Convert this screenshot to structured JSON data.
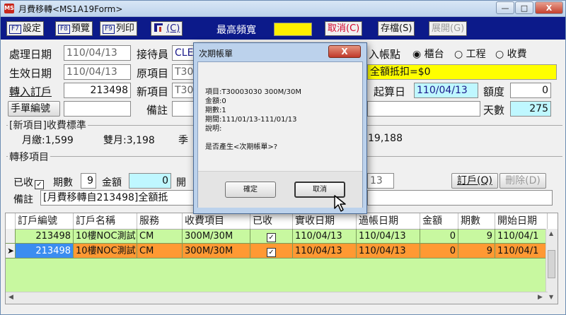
{
  "window": {
    "app_icon_text": "MS",
    "title": "月費移轉<MS1A19Form>",
    "minimize": "—",
    "maximize": "□",
    "close": "X"
  },
  "toolbar": {
    "set_key": "F7",
    "set_label": "設定",
    "preview_key": "F8",
    "preview_label": "預覽",
    "print_key": "F9",
    "print_label": "列印",
    "c_label": "(C)",
    "title": "最高頻寬",
    "cancel_label": "取消(C)",
    "save_label": "存檔(S)",
    "expand_label": "展開(G)"
  },
  "form": {
    "process_date_label": "處理日期",
    "process_date": "110/04/13",
    "operator_label": "接待員",
    "operator": "CLE",
    "entry_point_label": "入帳點",
    "entry_points": [
      "櫃台",
      "工程",
      "收費"
    ],
    "effective_date_label": "生效日期",
    "effective_date": "110/04/13",
    "orig_item_label": "原項目",
    "orig_item": "T30",
    "discount": "全額抵扣=$0",
    "transfer_customer_label": "轉入訂戶",
    "transfer_customer": "213498",
    "new_item_label": "新項目",
    "new_item": "T30",
    "calc_date_label": "起算日",
    "calc_date": "110/04/13",
    "quota_label": "額度",
    "quota": "0",
    "handbill_label": "手單編號",
    "remark_label": "備註",
    "days_label": "天數",
    "days": "275"
  },
  "fee_section": {
    "title": "[新項目]收費標準",
    "monthly": "月繳:1,599",
    "bimonthly": "雙月:3,198",
    "season": "季",
    "total": "19,188"
  },
  "transfer_section": {
    "title": "轉移項目",
    "received_label": "已收",
    "periods_label": "期數",
    "periods": "9",
    "amount_label": "金額",
    "amount": "0",
    "open_label": "開",
    "date_tail": "13",
    "remark_label": "備註",
    "remark": "[月費移轉自213498]全額抵",
    "customer_btn": "訂戶(Q)",
    "delete_btn": "刪除(D)"
  },
  "grid": {
    "headers": [
      "訂戶編號",
      "訂戶名稱",
      "服務",
      "收費項目",
      "已收",
      "實收日期",
      "過帳日期",
      "金額",
      "期數",
      "開始日期"
    ],
    "rows": [
      {
        "id": "213498",
        "name": "10樓NOC測試",
        "service": "CM",
        "item": "300M/30M",
        "received": "✓",
        "paid": "110/04/13",
        "posted": "110/04/13",
        "amount": "0",
        "periods": "9",
        "start": "110/04/1"
      },
      {
        "id": "213498",
        "name": "10樓NOC測試",
        "service": "CM",
        "item": "300M/30M",
        "received": "✓",
        "paid": "110/04/13",
        "posted": "110/04/13",
        "amount": "0",
        "periods": "9",
        "start": "110/04/1"
      }
    ]
  },
  "dialog": {
    "title": "次期帳單",
    "close": "X",
    "item_line": "項目:T30003030 300M/30M",
    "amount_line": "金額:0",
    "periods_line": "期數:1",
    "period_line": "期間:111/01/13-111/01/13",
    "note_line": "說明:",
    "question": "是否產生<次期帳單>?",
    "ok": "確定",
    "cancel": "取消"
  }
}
